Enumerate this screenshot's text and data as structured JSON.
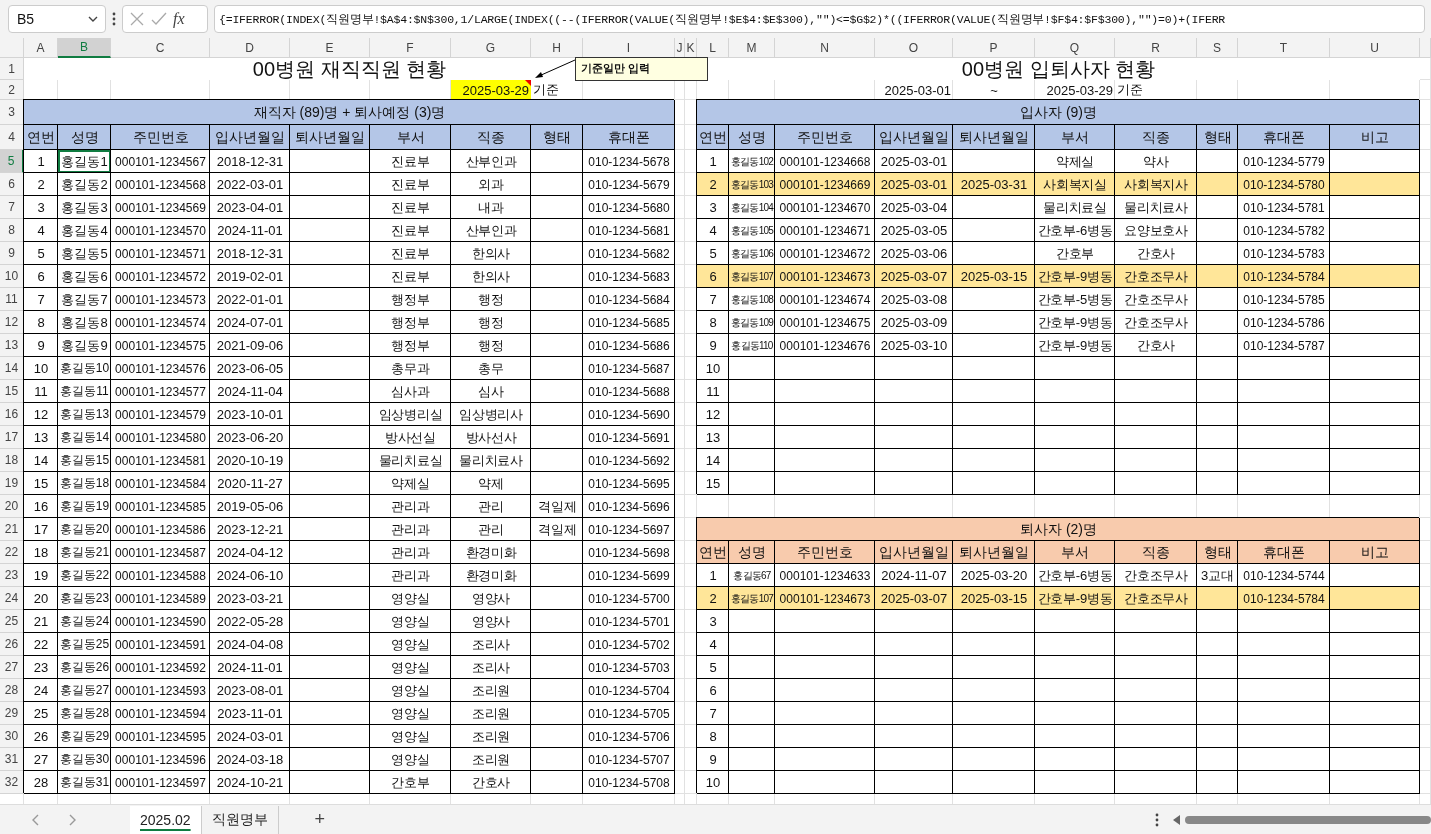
{
  "formula_bar": {
    "name_box": "B5",
    "function_label": "fx",
    "formula": "{=IFERROR(INDEX(직원명부!$A$4:$N$300,1/LARGE(INDEX((--(IFERROR(VALUE(직원명부!$E$4:$E$300),\"\")<=$G$2)*((IFERROR(VALUE(직원명부!$F$4:$F$300),\"\")=0)+(IFERR"
  },
  "column_headers": [
    {
      "label": "A",
      "selected": false
    },
    {
      "label": "B",
      "selected": true
    },
    {
      "label": "C",
      "selected": false
    },
    {
      "label": "D",
      "selected": false
    },
    {
      "label": "E",
      "selected": false
    },
    {
      "label": "F",
      "selected": false
    },
    {
      "label": "G",
      "selected": false
    },
    {
      "label": "H",
      "selected": false
    },
    {
      "label": "I",
      "selected": false
    },
    {
      "label": "J",
      "selected": false
    },
    {
      "label": "K",
      "selected": false
    },
    {
      "label": "L",
      "selected": false
    },
    {
      "label": "M",
      "selected": false
    },
    {
      "label": "N",
      "selected": false
    },
    {
      "label": "O",
      "selected": false
    },
    {
      "label": "P",
      "selected": false
    },
    {
      "label": "Q",
      "selected": false
    },
    {
      "label": "R",
      "selected": false
    },
    {
      "label": "S",
      "selected": false
    },
    {
      "label": "T",
      "selected": false
    },
    {
      "label": "U",
      "selected": false
    }
  ],
  "row_headers": [
    {
      "label": "1",
      "selected": false
    },
    {
      "label": "2",
      "selected": false
    },
    {
      "label": "3",
      "selected": false
    },
    {
      "label": "4",
      "selected": false
    },
    {
      "label": "5",
      "selected": true
    },
    {
      "label": "6",
      "selected": false
    },
    {
      "label": "7",
      "selected": false
    },
    {
      "label": "8",
      "selected": false
    },
    {
      "label": "9",
      "selected": false
    },
    {
      "label": "10",
      "selected": false
    },
    {
      "label": "11",
      "selected": false
    },
    {
      "label": "12",
      "selected": false
    },
    {
      "label": "13",
      "selected": false
    },
    {
      "label": "14",
      "selected": false
    },
    {
      "label": "15",
      "selected": false
    },
    {
      "label": "16",
      "selected": false
    },
    {
      "label": "17",
      "selected": false
    },
    {
      "label": "18",
      "selected": false
    },
    {
      "label": "19",
      "selected": false
    },
    {
      "label": "20",
      "selected": false
    },
    {
      "label": "21",
      "selected": false
    },
    {
      "label": "22",
      "selected": false
    },
    {
      "label": "23",
      "selected": false
    },
    {
      "label": "24",
      "selected": false
    },
    {
      "label": "25",
      "selected": false
    },
    {
      "label": "26",
      "selected": false
    },
    {
      "label": "27",
      "selected": false
    },
    {
      "label": "28",
      "selected": false
    },
    {
      "label": "29",
      "selected": false
    },
    {
      "label": "30",
      "selected": false
    },
    {
      "label": "31",
      "selected": false
    },
    {
      "label": "32",
      "selected": false
    }
  ],
  "staff": {
    "title": "00병원 재직직원 현황",
    "base_date": "2025-03-29",
    "base_label": "기준",
    "comment": "기준일만 입력",
    "header": "재직자 (89)명 + 퇴사예정 (3)명",
    "columns": [
      "연번",
      "성명",
      "주민번호",
      "입사년월일",
      "퇴사년월일",
      "부서",
      "직종",
      "형태",
      "휴대폰"
    ],
    "rows": [
      {
        "no": "1",
        "name": "홍길동1",
        "id": "000101-1234567",
        "hired": "2018-12-31",
        "dept": "진료부",
        "job": "산부인과",
        "phone": "010-1234-5678",
        "active": true
      },
      {
        "no": "2",
        "name": "홍길동2",
        "id": "000101-1234568",
        "hired": "2022-03-01",
        "dept": "진료부",
        "job": "외과",
        "phone": "010-1234-5679",
        "active": false
      },
      {
        "no": "3",
        "name": "홍길동3",
        "id": "000101-1234569",
        "hired": "2023-04-01",
        "dept": "진료부",
        "job": "내과",
        "phone": "010-1234-5680",
        "active": false
      },
      {
        "no": "4",
        "name": "홍길동4",
        "id": "000101-1234570",
        "hired": "2024-11-01",
        "dept": "진료부",
        "job": "산부인과",
        "phone": "010-1234-5681",
        "active": false
      },
      {
        "no": "5",
        "name": "홍길동5",
        "id": "000101-1234571",
        "hired": "2018-12-31",
        "dept": "진료부",
        "job": "한의사",
        "phone": "010-1234-5682",
        "active": false
      },
      {
        "no": "6",
        "name": "홍길동6",
        "id": "000101-1234572",
        "hired": "2019-02-01",
        "dept": "진료부",
        "job": "한의사",
        "phone": "010-1234-5683",
        "active": false
      },
      {
        "no": "7",
        "name": "홍길동7",
        "id": "000101-1234573",
        "hired": "2022-01-01",
        "dept": "행정부",
        "job": "행정",
        "phone": "010-1234-5684",
        "active": false
      },
      {
        "no": "8",
        "name": "홍길동8",
        "id": "000101-1234574",
        "hired": "2024-07-01",
        "dept": "행정부",
        "job": "행정",
        "phone": "010-1234-5685",
        "active": false
      },
      {
        "no": "9",
        "name": "홍길동9",
        "id": "000101-1234575",
        "hired": "2021-09-06",
        "dept": "행정부",
        "job": "행정",
        "phone": "010-1234-5686",
        "active": false
      },
      {
        "no": "10",
        "name": "홍길동10",
        "id": "000101-1234576",
        "hired": "2023-06-05",
        "dept": "총무과",
        "job": "총무",
        "phone": "010-1234-5687",
        "active": false
      },
      {
        "no": "11",
        "name": "홍길동11",
        "id": "000101-1234577",
        "hired": "2024-11-04",
        "dept": "심사과",
        "job": "심사",
        "phone": "010-1234-5688",
        "active": false
      },
      {
        "no": "12",
        "name": "홍길동13",
        "id": "000101-1234579",
        "hired": "2023-10-01",
        "dept": "임상병리실",
        "job": "임상병리사",
        "phone": "010-1234-5690",
        "active": false
      },
      {
        "no": "13",
        "name": "홍길동14",
        "id": "000101-1234580",
        "hired": "2023-06-20",
        "dept": "방사선실",
        "job": "방사선사",
        "phone": "010-1234-5691",
        "active": false
      },
      {
        "no": "14",
        "name": "홍길동15",
        "id": "000101-1234581",
        "hired": "2020-10-19",
        "dept": "물리치료실",
        "job": "물리치료사",
        "phone": "010-1234-5692",
        "active": false
      },
      {
        "no": "15",
        "name": "홍길동18",
        "id": "000101-1234584",
        "hired": "2020-11-27",
        "dept": "약제실",
        "job": "약제",
        "phone": "010-1234-5695",
        "active": false
      },
      {
        "no": "16",
        "name": "홍길동19",
        "id": "000101-1234585",
        "hired": "2019-05-06",
        "dept": "관리과",
        "job": "관리",
        "type": "격일제",
        "phone": "010-1234-5696",
        "active": false
      },
      {
        "no": "17",
        "name": "홍길동20",
        "id": "000101-1234586",
        "hired": "2023-12-21",
        "dept": "관리과",
        "job": "관리",
        "type": "격일제",
        "phone": "010-1234-5697",
        "active": false
      },
      {
        "no": "18",
        "name": "홍길동21",
        "id": "000101-1234587",
        "hired": "2024-04-12",
        "dept": "관리과",
        "job": "환경미화",
        "phone": "010-1234-5698",
        "active": false
      },
      {
        "no": "19",
        "name": "홍길동22",
        "id": "000101-1234588",
        "hired": "2024-06-10",
        "dept": "관리과",
        "job": "환경미화",
        "phone": "010-1234-5699",
        "active": false
      },
      {
        "no": "20",
        "name": "홍길동23",
        "id": "000101-1234589",
        "hired": "2023-03-21",
        "dept": "영양실",
        "job": "영양사",
        "phone": "010-1234-5700",
        "active": false
      },
      {
        "no": "21",
        "name": "홍길동24",
        "id": "000101-1234590",
        "hired": "2022-05-28",
        "dept": "영양실",
        "job": "영양사",
        "phone": "010-1234-5701",
        "active": false
      },
      {
        "no": "22",
        "name": "홍길동25",
        "id": "000101-1234591",
        "hired": "2024-04-08",
        "dept": "영양실",
        "job": "조리사",
        "phone": "010-1234-5702",
        "active": false
      },
      {
        "no": "23",
        "name": "홍길동26",
        "id": "000101-1234592",
        "hired": "2024-11-01",
        "dept": "영양실",
        "job": "조리사",
        "phone": "010-1234-5703",
        "active": false
      },
      {
        "no": "24",
        "name": "홍길동27",
        "id": "000101-1234593",
        "hired": "2023-08-01",
        "dept": "영양실",
        "job": "조리원",
        "phone": "010-1234-5704",
        "active": false
      },
      {
        "no": "25",
        "name": "홍길동28",
        "id": "000101-1234594",
        "hired": "2023-11-01",
        "dept": "영양실",
        "job": "조리원",
        "phone": "010-1234-5705",
        "active": false
      },
      {
        "no": "26",
        "name": "홍길동29",
        "id": "000101-1234595",
        "hired": "2024-03-01",
        "dept": "영양실",
        "job": "조리원",
        "phone": "010-1234-5706",
        "active": false
      },
      {
        "no": "27",
        "name": "홍길동30",
        "id": "000101-1234596",
        "hired": "2024-03-18",
        "dept": "영양실",
        "job": "조리원",
        "phone": "010-1234-5707",
        "active": false
      },
      {
        "no": "28",
        "name": "홍길동31",
        "id": "000101-1234597",
        "hired": "2024-10-21",
        "dept": "간호부",
        "job": "간호사",
        "phone": "010-1234-5708",
        "active": false
      }
    ]
  },
  "turnover": {
    "title": "00병원 입퇴사자 현황",
    "period_start": "2025-03-01",
    "period_separator": "~",
    "period_end": "2025-03-29",
    "base_label": "기준",
    "hires": {
      "header": "입사자 (9)명",
      "columns": [
        "연번",
        "성명",
        "주민번호",
        "입사년월일",
        "퇴사년월일",
        "부서",
        "직종",
        "형태",
        "휴대폰",
        "비고"
      ],
      "rows": [
        {
          "no": "1",
          "name": "홍길동102",
          "id": "000101-1234668",
          "hired": "2025-03-01",
          "dept": "약제실",
          "job": "약사",
          "phone": "010-1234-5779",
          "highlighted": false
        },
        {
          "no": "2",
          "name": "홍길동103",
          "id": "000101-1234669",
          "hired": "2025-03-01",
          "resigned": "2025-03-31",
          "dept": "사회복지실",
          "job": "사회복지사",
          "phone": "010-1234-5780",
          "highlighted": true
        },
        {
          "no": "3",
          "name": "홍길동104",
          "id": "000101-1234670",
          "hired": "2025-03-04",
          "dept": "물리치료실",
          "job": "물리치료사",
          "phone": "010-1234-5781",
          "highlighted": false
        },
        {
          "no": "4",
          "name": "홍길동105",
          "id": "000101-1234671",
          "hired": "2025-03-05",
          "dept": "간호부-6병동",
          "job": "요양보호사",
          "phone": "010-1234-5782",
          "highlighted": false
        },
        {
          "no": "5",
          "name": "홍길동106",
          "id": "000101-1234672",
          "hired": "2025-03-06",
          "dept": "간호부",
          "job": "간호사",
          "phone": "010-1234-5783",
          "highlighted": false
        },
        {
          "no": "6",
          "name": "홍길동107",
          "id": "000101-1234673",
          "hired": "2025-03-07",
          "resigned": "2025-03-15",
          "dept": "간호부-9병동",
          "job": "간호조무사",
          "phone": "010-1234-5784",
          "highlighted": true
        },
        {
          "no": "7",
          "name": "홍길동108",
          "id": "000101-1234674",
          "hired": "2025-03-08",
          "dept": "간호부-5병동",
          "job": "간호조무사",
          "phone": "010-1234-5785",
          "highlighted": false
        },
        {
          "no": "8",
          "name": "홍길동109",
          "id": "000101-1234675",
          "hired": "2025-03-09",
          "dept": "간호부-9병동",
          "job": "간호조무사",
          "phone": "010-1234-5786",
          "highlighted": false
        },
        {
          "no": "9",
          "name": "홍길동110",
          "id": "000101-1234676",
          "hired": "2025-03-10",
          "dept": "간호부-9병동",
          "job": "간호사",
          "phone": "010-1234-5787",
          "highlighted": false
        },
        {
          "no": "10",
          "highlighted": false
        },
        {
          "no": "11",
          "highlighted": false
        },
        {
          "no": "12",
          "highlighted": false
        },
        {
          "no": "13",
          "highlighted": false
        },
        {
          "no": "14",
          "highlighted": false
        },
        {
          "no": "15",
          "highlighted": false
        }
      ]
    },
    "resignations": {
      "header": "퇴사자 (2)명",
      "columns": [
        "연번",
        "성명",
        "주민번호",
        "입사년월일",
        "퇴사년월일",
        "부서",
        "직종",
        "형태",
        "휴대폰",
        "비고"
      ],
      "rows": [
        {
          "no": "1",
          "name": "홍길동67",
          "id": "000101-1234633",
          "hired": "2024-11-07",
          "resigned": "2025-03-20",
          "dept": "간호부-6병동",
          "job": "간호조무사",
          "type": "3교대",
          "phone": "010-1234-5744",
          "highlighted": false
        },
        {
          "no": "2",
          "name": "홍길동107",
          "id": "000101-1234673",
          "hired": "2025-03-07",
          "resigned": "2025-03-15",
          "dept": "간호부-9병동",
          "job": "간호조무사",
          "phone": "010-1234-5784",
          "highlighted": true
        },
        {
          "no": "3",
          "highlighted": false
        },
        {
          "no": "4",
          "highlighted": false
        },
        {
          "no": "5",
          "highlighted": false
        },
        {
          "no": "6",
          "highlighted": false
        },
        {
          "no": "7",
          "highlighted": false
        },
        {
          "no": "8",
          "highlighted": false
        },
        {
          "no": "9",
          "highlighted": false
        },
        {
          "no": "10",
          "highlighted": false
        }
      ]
    }
  },
  "sheet_tabs": [
    {
      "label": "2025.02",
      "selected": true
    },
    {
      "label": "직원명부",
      "selected": false
    }
  ],
  "add_sheet": "+"
}
